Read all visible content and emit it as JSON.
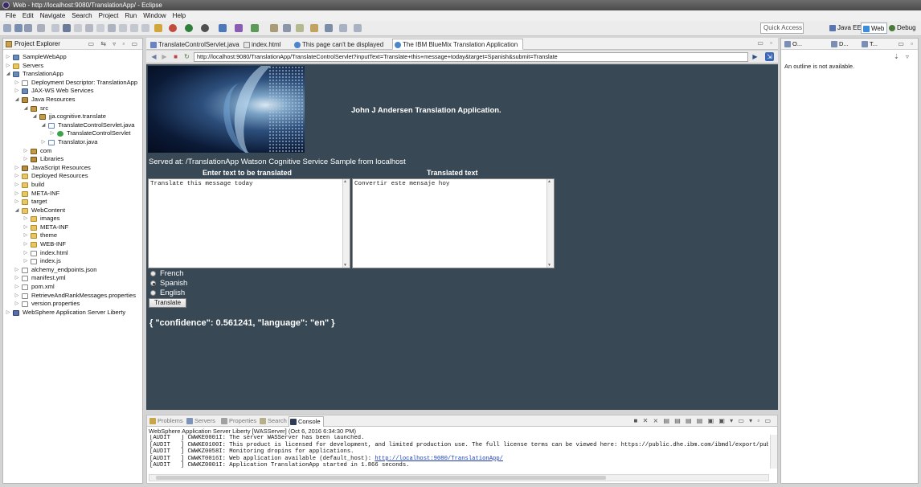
{
  "window": {
    "title": "Web - http://localhost:9080/TranslationApp/ - Eclipse"
  },
  "menu": [
    "File",
    "Edit",
    "Navigate",
    "Search",
    "Project",
    "Run",
    "Window",
    "Help"
  ],
  "toolbar": {
    "quick_access_placeholder": "Quick Access",
    "perspectives": [
      "Java EE",
      "Web",
      "Debug"
    ]
  },
  "project_explorer": {
    "title": "Project Explorer",
    "tree": [
      {
        "label": "SampleWebApp",
        "depth": 0,
        "icon": "project-icon",
        "expanded": false
      },
      {
        "label": "Servers",
        "depth": 0,
        "icon": "folder-icon",
        "expanded": false
      },
      {
        "label": "TranslationApp",
        "depth": 0,
        "icon": "project-icon",
        "expanded": true
      },
      {
        "label": "Deployment Descriptor: TranslationApp",
        "depth": 1,
        "icon": "descriptor-icon",
        "expanded": false
      },
      {
        "label": "JAX-WS Web Services",
        "depth": 1,
        "icon": "webservice-icon",
        "expanded": false
      },
      {
        "label": "Java Resources",
        "depth": 1,
        "icon": "java-resources-icon",
        "expanded": true
      },
      {
        "label": "src",
        "depth": 2,
        "icon": "source-folder-icon",
        "expanded": true
      },
      {
        "label": "jja.cognitive.translate",
        "depth": 3,
        "icon": "package-icon",
        "expanded": true
      },
      {
        "label": "TranslateControlServlet.java",
        "depth": 4,
        "icon": "java-file-icon",
        "expanded": true
      },
      {
        "label": "TranslateControlServlet",
        "depth": 5,
        "icon": "class-icon",
        "expanded": false
      },
      {
        "label": "Translator.java",
        "depth": 4,
        "icon": "java-file-icon",
        "expanded": false
      },
      {
        "label": "com",
        "depth": 2,
        "icon": "package-icon",
        "expanded": false
      },
      {
        "label": "Libraries",
        "depth": 2,
        "icon": "library-icon",
        "expanded": false
      },
      {
        "label": "JavaScript Resources",
        "depth": 1,
        "icon": "js-resources-icon",
        "expanded": false
      },
      {
        "label": "Deployed Resources",
        "depth": 1,
        "icon": "folder-icon",
        "expanded": false
      },
      {
        "label": "build",
        "depth": 1,
        "icon": "folder-icon",
        "expanded": false
      },
      {
        "label": "META-INF",
        "depth": 1,
        "icon": "folder-icon",
        "expanded": false
      },
      {
        "label": "target",
        "depth": 1,
        "icon": "folder-icon",
        "expanded": false
      },
      {
        "label": "WebContent",
        "depth": 1,
        "icon": "folder-icon",
        "expanded": true
      },
      {
        "label": "images",
        "depth": 2,
        "icon": "folder-icon",
        "expanded": false
      },
      {
        "label": "META-INF",
        "depth": 2,
        "icon": "folder-icon",
        "expanded": false
      },
      {
        "label": "theme",
        "depth": 2,
        "icon": "folder-icon",
        "expanded": false
      },
      {
        "label": "WEB-INF",
        "depth": 2,
        "icon": "folder-icon",
        "expanded": false
      },
      {
        "label": "index.html",
        "depth": 2,
        "icon": "html-file-icon",
        "expanded": false
      },
      {
        "label": "index.js",
        "depth": 2,
        "icon": "js-file-icon",
        "expanded": false
      },
      {
        "label": "alchemy_endpoints.json",
        "depth": 1,
        "icon": "file-icon",
        "expanded": false
      },
      {
        "label": "manifest.yml",
        "depth": 1,
        "icon": "file-icon",
        "expanded": false
      },
      {
        "label": "pom.xml",
        "depth": 1,
        "icon": "xml-file-icon",
        "expanded": false
      },
      {
        "label": "RetrieveAndRankMessages.properties",
        "depth": 1,
        "icon": "file-icon",
        "expanded": false
      },
      {
        "label": "version.properties",
        "depth": 1,
        "icon": "file-icon",
        "expanded": false
      },
      {
        "label": "WebSphere Application Server Liberty",
        "depth": 0,
        "icon": "server-icon",
        "expanded": false
      }
    ]
  },
  "editor_tabs": [
    {
      "label": "TranslateControlServlet.java",
      "active": false
    },
    {
      "label": "index.html",
      "active": false
    },
    {
      "label": "This page can't be displayed",
      "active": false
    },
    {
      "label": "The IBM BlueMix Translation Application",
      "active": true
    }
  ],
  "browser": {
    "url": "http://localhost:9080/TranslationApp/TranslateControlServlet?inputText=Translate+this+message+today&target=Spanish&submit=Translate"
  },
  "page": {
    "heading": "John J Andersen Translation Application.",
    "served_at": "Served at: /TranslationApp Watson Cognitive Service Sample from localhost",
    "input_label": "Enter text to be translated",
    "output_label": "Translated text",
    "input_text": "Translate this message today",
    "output_text": "Convertir este mensaje hoy",
    "languages": [
      {
        "label": "French",
        "selected": false
      },
      {
        "label": "Spanish",
        "selected": true
      },
      {
        "label": "English",
        "selected": false
      }
    ],
    "submit_label": "Translate",
    "result": "{ \"confidence\": 0.561241, \"language\": \"en\" }"
  },
  "bottom_tabs": [
    {
      "label": "Problems",
      "active": false
    },
    {
      "label": "Servers",
      "active": false
    },
    {
      "label": "Properties",
      "active": false
    },
    {
      "label": "Search",
      "active": false
    },
    {
      "label": "Console",
      "active": true
    }
  ],
  "console": {
    "description": "WebSphere Application Server Liberty [WASServer] (Oct 6, 2016 6:34:30 PM)",
    "lines": [
      "[AUDIT   ] CWWKE0001I: The server WASServer has been launched.",
      "[AUDIT   ] CWWKE0100I: This product is licensed for development, and limited production use. The full license terms can be viewed here: https://public.dhe.ibm.com/ibmdl/export/pub/softw",
      "[AUDIT   ] CWWKZ0058I: Monitoring dropins for applications.",
      "[AUDIT   ] CWWKT0016I: Web application available (default_host): ",
      "[AUDIT   ] CWWKZ0001I: Application TranslationApp started in 1.866 seconds."
    ],
    "link": "http://localhost:9080/TranslationApp/"
  },
  "outline": {
    "tabs": [
      "O...",
      "D...",
      "T..."
    ],
    "message": "An outline is not available."
  },
  "colors": {
    "page_background": "#384955",
    "link": "#1a3cb8"
  }
}
